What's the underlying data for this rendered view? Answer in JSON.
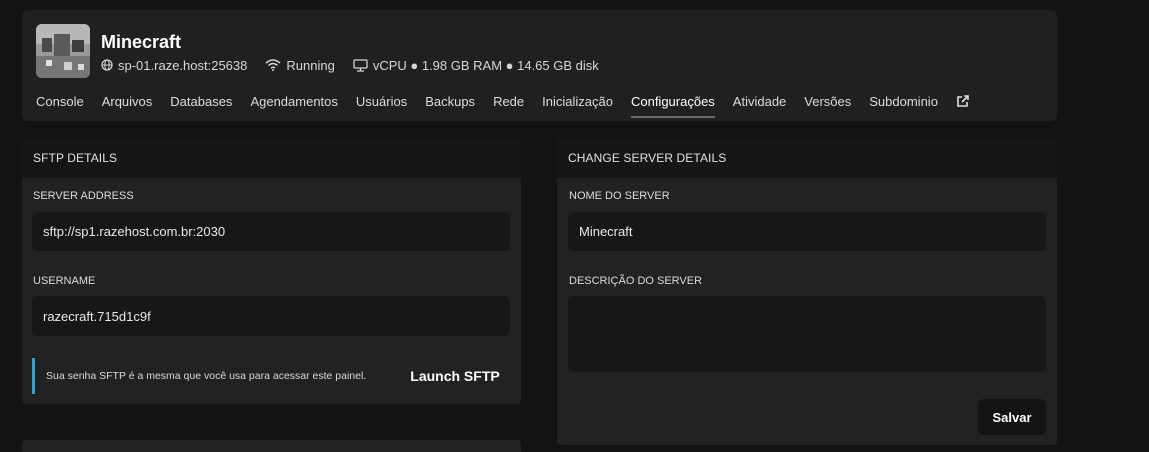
{
  "header": {
    "server_name": "Minecraft",
    "address": "sp-01.raze.host:25638",
    "status": "Running",
    "resources": "vCPU ● 1.98 GB RAM ● 14.65 GB disk",
    "icons": [
      "globe-icon",
      "wifi-icon",
      "monitor-icon",
      "external-link-icon"
    ]
  },
  "tabs": [
    {
      "label": "Console"
    },
    {
      "label": "Arquivos"
    },
    {
      "label": "Databases"
    },
    {
      "label": "Agendamentos"
    },
    {
      "label": "Usuários"
    },
    {
      "label": "Backups"
    },
    {
      "label": "Rede"
    },
    {
      "label": "Inicialização"
    },
    {
      "label": "Configurações",
      "active": true
    },
    {
      "label": "Atividade"
    },
    {
      "label": "Versões"
    },
    {
      "label": "Subdominio"
    }
  ],
  "sftp": {
    "title": "SFTP DETAILS",
    "address_label": "SERVER ADDRESS",
    "address_value": "sftp://sp1.razehost.com.br:2030",
    "username_label": "USERNAME",
    "username_value": "razecraft.715d1c9f",
    "notice": "Sua senha SFTP é a mesma que você usa para acessar este painel.",
    "launch_label": "Launch SFTP"
  },
  "details": {
    "title": "CHANGE SERVER DETAILS",
    "name_label": "NOME DO SERVER",
    "name_value": "Minecraft",
    "description_label": "DESCRIÇÃO DO SERVER",
    "description_value": "",
    "save_label": "Salvar"
  },
  "colors": {
    "background": "#131313",
    "card": "#202020",
    "panel_header": "#161616",
    "input": "#171717",
    "notice_accent": "#2aa7d6"
  }
}
